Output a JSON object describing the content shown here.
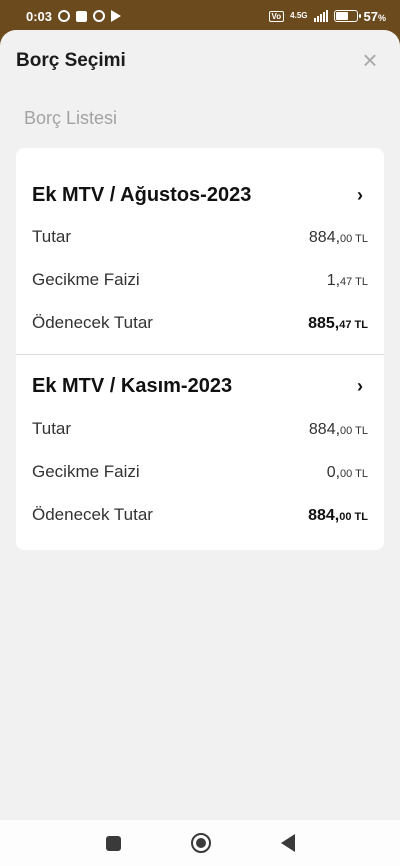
{
  "status_bar": {
    "time": "0:03",
    "network": "4.5G",
    "volte": "Vo",
    "battery_value": "57",
    "battery_unit": "%"
  },
  "sheet": {
    "title": "Borç Seçimi",
    "close_symbol": "×",
    "section_title": "Borç Listesi"
  },
  "debts": [
    {
      "title": "Ek MTV / Ağustos-2023",
      "chevron": "›",
      "rows": [
        {
          "label": "Tutar",
          "int": "884,",
          "dec": "00",
          "cur": " TL"
        },
        {
          "label": "Gecikme Faizi",
          "int": "1,",
          "dec": "47",
          "cur": " TL"
        },
        {
          "label": "Ödenecek Tutar",
          "int": "885,",
          "dec": "47",
          "cur": " TL"
        }
      ]
    },
    {
      "title": "Ek MTV / Kasım-2023",
      "chevron": "›",
      "rows": [
        {
          "label": "Tutar",
          "int": "884,",
          "dec": "00",
          "cur": " TL"
        },
        {
          "label": "Gecikme Faizi",
          "int": "0,",
          "dec": "00",
          "cur": " TL"
        },
        {
          "label": "Ödenecek Tutar",
          "int": "884,",
          "dec": "00",
          "cur": " TL"
        }
      ]
    }
  ],
  "colors": {
    "status_bar_bg": "#6b4a1e",
    "sheet_bg": "#f1f1f1",
    "card_bg": "#ffffff",
    "muted_text": "#a3a3a3"
  },
  "icons": {
    "status_left": [
      "alarm-icon",
      "square-notification-icon",
      "clock-icon",
      "play-store-icon"
    ],
    "status_right": [
      "volte-icon",
      "signal-icon",
      "battery-icon"
    ],
    "nav": [
      "recents-icon",
      "home-icon",
      "back-icon"
    ]
  }
}
